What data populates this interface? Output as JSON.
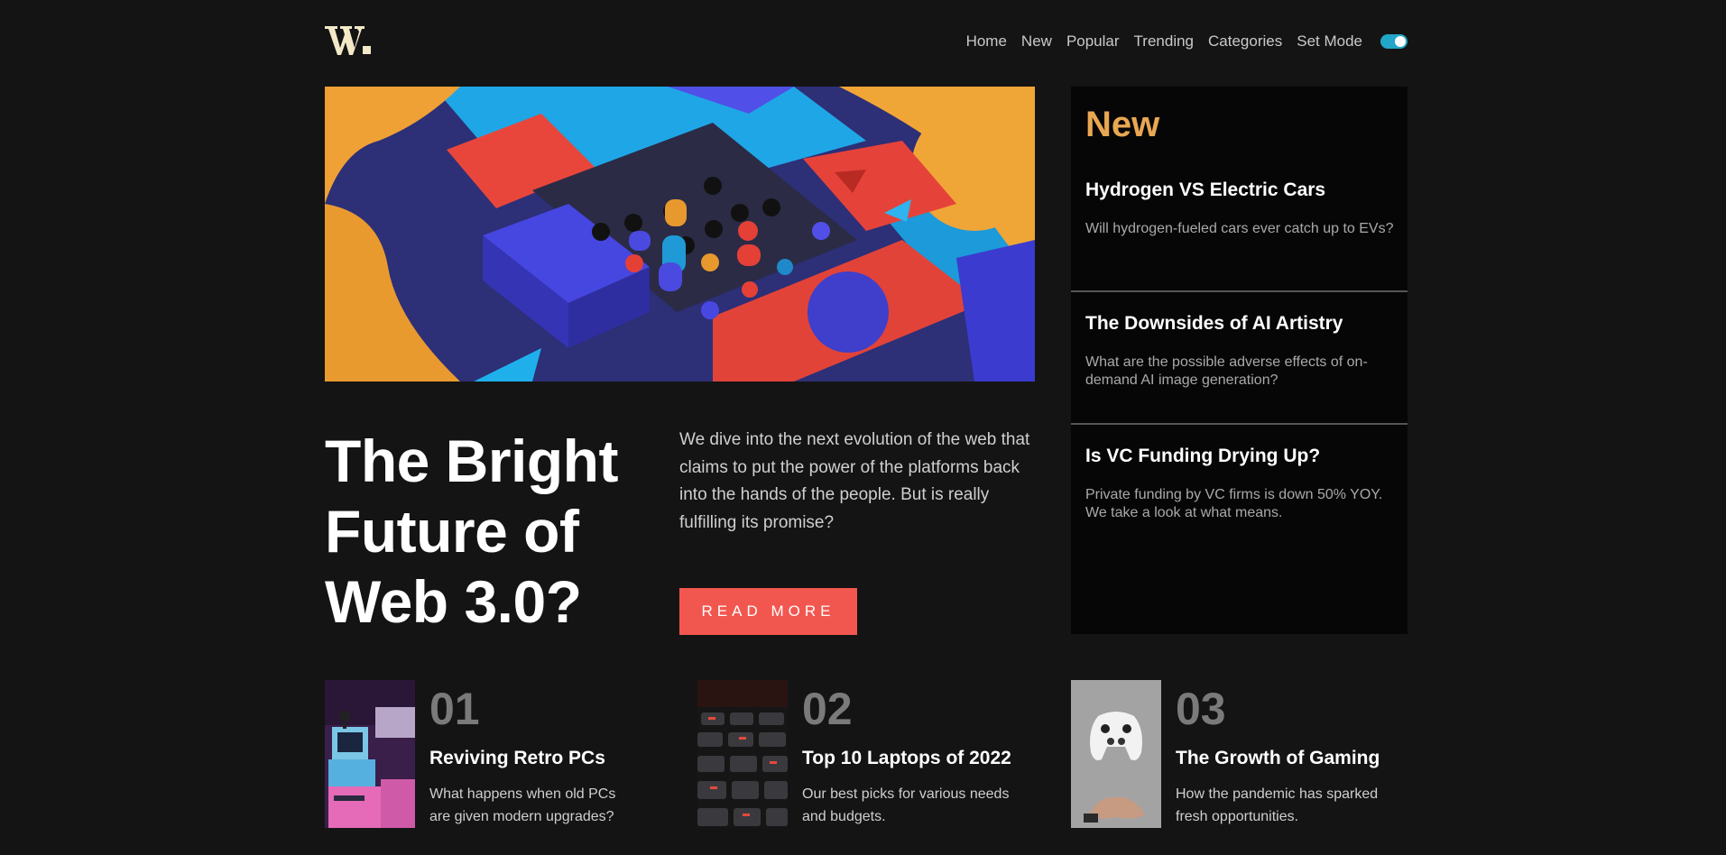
{
  "brand": {
    "logo_text": "W."
  },
  "nav": {
    "items": [
      {
        "label": "Home"
      },
      {
        "label": "New"
      },
      {
        "label": "Popular"
      },
      {
        "label": "Trending"
      },
      {
        "label": "Categories"
      },
      {
        "label": "Set Mode"
      }
    ],
    "mode_toggle_on": true,
    "toggle_color": "#22a6c9"
  },
  "hero": {
    "title": "The Bright Future of Web 3.0?",
    "blurb": "We dive into the next evolution of the web that claims to put the power of the platforms back into the hands of the people. But is really fulfilling its promise?",
    "button_label": "Read more",
    "accent_color": "#f2574f"
  },
  "new_panel": {
    "heading": "New",
    "heading_color": "#e9a752",
    "items": [
      {
        "title": "Hydrogen VS Electric Cars",
        "desc": "Will hydrogen-fueled cars ever catch up to EVs?"
      },
      {
        "title": "The Downsides of AI Artistry",
        "desc": "What are the possible adverse effects of on-demand AI image generation?"
      },
      {
        "title": "Is VC Funding Drying Up?",
        "desc": "Private funding by VC firms is down 50% YOY. We take a look at what means."
      }
    ]
  },
  "cards": [
    {
      "num": "01",
      "title": "Reviving Retro PCs",
      "desc": "What happens when old PCs are given modern upgrades?"
    },
    {
      "num": "02",
      "title": "Top 10 Laptops of 2022",
      "desc": "Our best picks for various needs and budgets."
    },
    {
      "num": "03",
      "title": "The Growth of Gaming",
      "desc": "How the pandemic has sparked fresh opportunities."
    }
  ]
}
